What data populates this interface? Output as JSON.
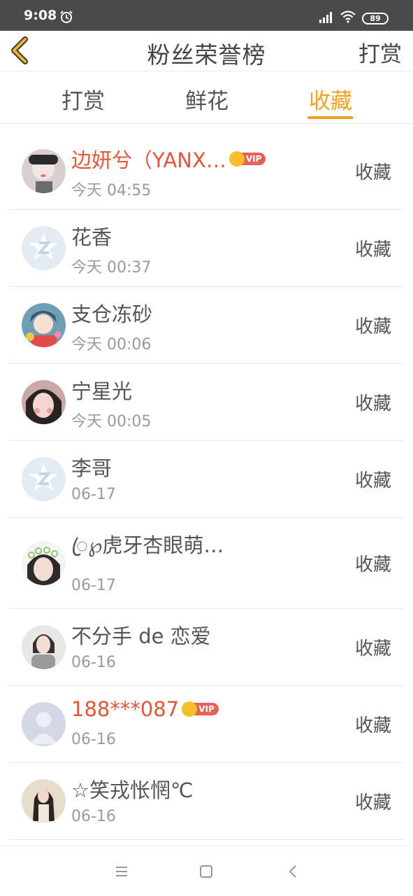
{
  "status_bar": {
    "time": "9:08",
    "battery": "89",
    "icons": [
      "alarm-icon",
      "signal-icon",
      "wifi-icon",
      "battery-icon"
    ]
  },
  "header": {
    "back_icon": "chevron-left-icon",
    "title": "粉丝荣誉榜",
    "right_label": "打赏"
  },
  "tabs": [
    {
      "label": "打赏",
      "active": false
    },
    {
      "label": "鲜花",
      "active": false
    },
    {
      "label": "收藏",
      "active": true
    }
  ],
  "colors": {
    "accent": "#f0a223",
    "vip_name": "#e0573a",
    "text": "#555555",
    "muted": "#9a9a9a"
  },
  "fans": [
    {
      "name": "边妍兮（YANX…",
      "time": "今天 04:55",
      "action": "收藏",
      "vip": true,
      "vip_label": "VIP",
      "avatar": "photo-avatar"
    },
    {
      "name": "花香",
      "time": "今天 00:37",
      "action": "收藏",
      "vip": false,
      "avatar": "default-avatar"
    },
    {
      "name": "支仓冻砂",
      "time": "今天 00:06",
      "action": "收藏",
      "vip": false,
      "avatar": "anime-avatar"
    },
    {
      "name": "宁星光",
      "time": "今天 00:05",
      "action": "收藏",
      "vip": false,
      "avatar": "photo-avatar"
    },
    {
      "name": "李哥",
      "time": "06-17",
      "action": "收藏",
      "vip": false,
      "avatar": "default-avatar"
    },
    {
      "name": "ꦿ℘虎牙杏眼萌…",
      "time": "06-17",
      "action": "收藏",
      "vip": false,
      "avatar": "photo-avatar"
    },
    {
      "name": "不分手 de 恋爱",
      "time": "06-16",
      "action": "收藏",
      "vip": false,
      "avatar": "photo-avatar"
    },
    {
      "name": "188***087",
      "time": "06-16",
      "action": "收藏",
      "vip": true,
      "vip_label": "VIP",
      "avatar": "blank-avatar"
    },
    {
      "name": "☆笑戎怅惘℃",
      "time": "06-16",
      "action": "收藏",
      "vip": false,
      "avatar": "photo-avatar"
    }
  ],
  "nav_bar": {
    "icons": [
      "menu-icon",
      "home-icon",
      "back-icon"
    ]
  }
}
